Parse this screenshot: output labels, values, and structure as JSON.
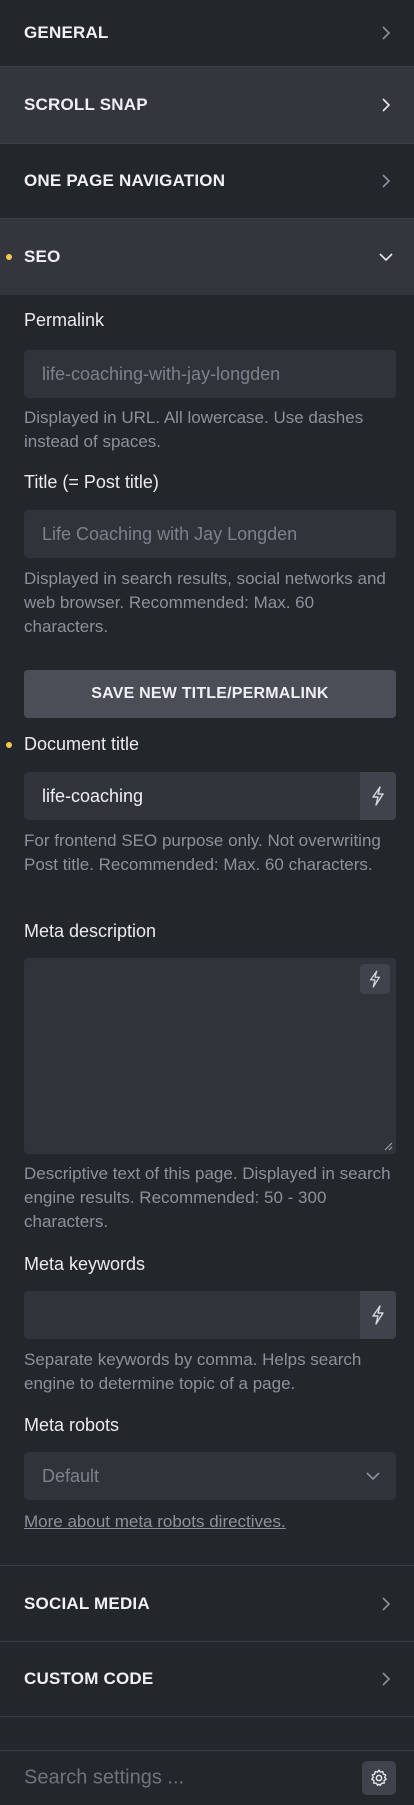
{
  "sections": {
    "general": "GENERAL",
    "scroll_snap": "SCROLL SNAP",
    "one_page_navigation": "ONE PAGE NAVIGATION",
    "seo": "SEO",
    "social_media": "SOCIAL MEDIA",
    "custom_code": "CUSTOM CODE"
  },
  "seo": {
    "permalink": {
      "label": "Permalink",
      "placeholder": "life-coaching-with-jay-longden",
      "help": "Displayed in URL. All lowercase. Use dashes instead of spaces."
    },
    "title": {
      "label": "Title (= Post title)",
      "placeholder": "Life Coaching with Jay Longden",
      "help": "Displayed in search results, social networks and web browser. Recommended: Max. 60 characters."
    },
    "save_button": "SAVE NEW TITLE/PERMALINK",
    "document_title": {
      "label": "Document title",
      "value": "life-coaching",
      "help": "For frontend SEO purpose only. Not overwriting Post title. Recommended: Max. 60 characters."
    },
    "meta_description": {
      "label": "Meta description",
      "value": "",
      "help": "Descriptive text of this page. Displayed in search engine results. Recommended: 50 - 300 characters."
    },
    "meta_keywords": {
      "label": "Meta keywords",
      "value": "",
      "help": "Separate keywords by comma. Helps search engine to determine topic of a page."
    },
    "meta_robots": {
      "label": "Meta robots",
      "selected": "Default",
      "link": "More about meta robots directives."
    }
  },
  "search": {
    "placeholder": "Search settings ..."
  },
  "colors": {
    "background": "#23262b",
    "active_section": "#33363d",
    "indicator_dot": "#f2c94c",
    "input_bg": "#30333a",
    "button_bg": "#4a4e57"
  },
  "icons": {
    "collapsed": "chevron-right-icon",
    "expanded": "chevron-down-icon",
    "dynamic_data": "bolt-icon",
    "settings": "gear-icon"
  }
}
